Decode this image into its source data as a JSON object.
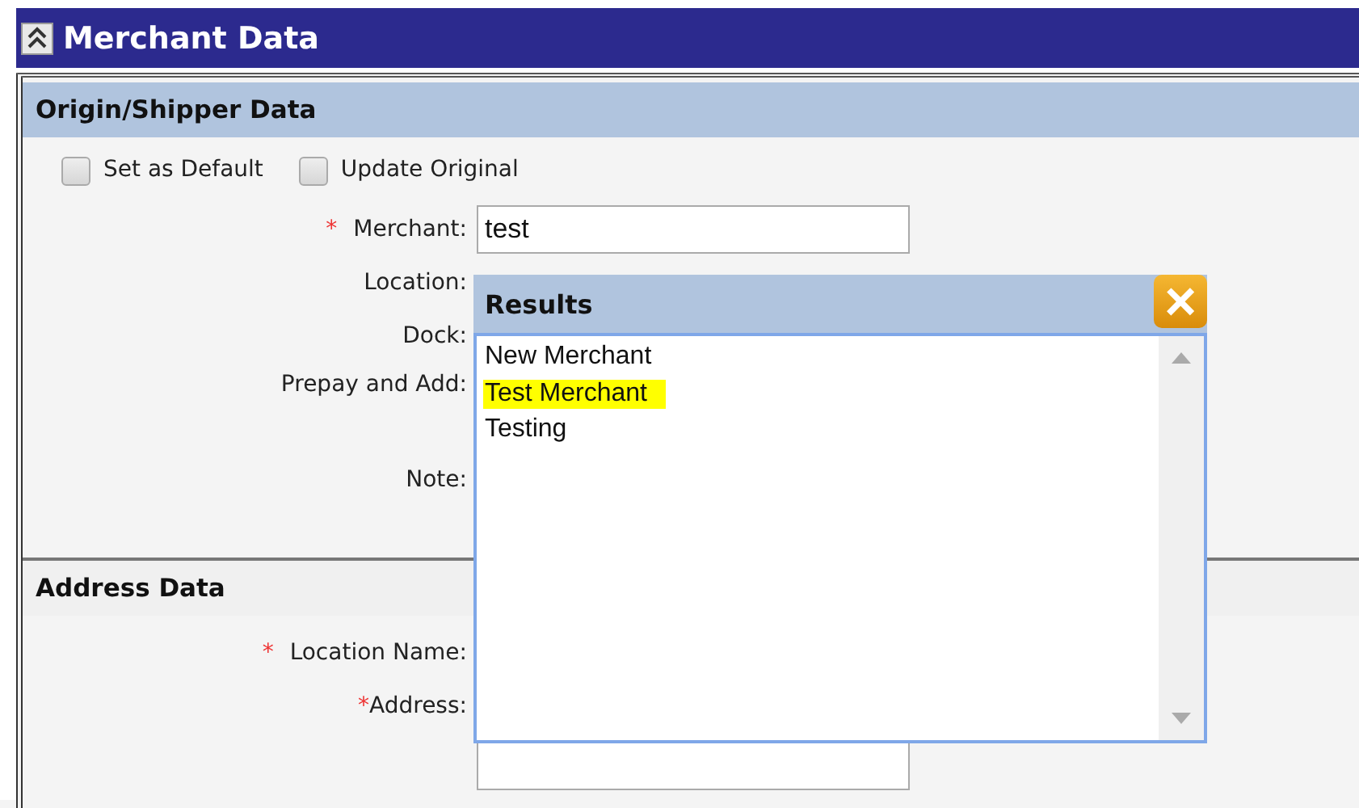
{
  "window": {
    "title": "Merchant Data"
  },
  "sections": [
    {
      "title": "Origin/Shipper Data",
      "options": [
        {
          "label": "Set as Default",
          "checked": false
        },
        {
          "label": "Update Original",
          "checked": false
        }
      ],
      "fields": [
        {
          "label": "Merchant:",
          "marker": "*",
          "value": "test"
        },
        {
          "label": "Location:"
        },
        {
          "label": "Dock:"
        },
        {
          "label": "Prepay and Add:",
          "kind": "tall"
        },
        {
          "label": "Note:"
        }
      ]
    },
    {
      "title": "Address Data",
      "kind": "plain",
      "fields": [
        {
          "label": "Location Name:",
          "marker": "*"
        },
        {
          "label": "Address:",
          "marker": "*",
          "kind": "tight"
        }
      ]
    }
  ],
  "results_popup": {
    "title": "Results",
    "close": "×",
    "items": [
      {
        "label": "New Merchant",
        "selected": false
      },
      {
        "label": "Test Merchant",
        "selected": true
      },
      {
        "label": "Testing",
        "selected": false
      }
    ]
  }
}
